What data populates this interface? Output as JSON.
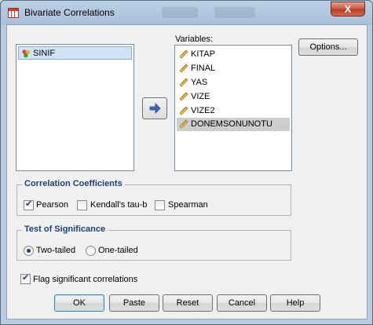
{
  "window": {
    "title": "Bivariate Correlations",
    "close_glyph": "X"
  },
  "source_list": {
    "items": [
      {
        "label": "SINIF",
        "selected": true
      }
    ]
  },
  "variables": {
    "label": "Variables:",
    "items": [
      {
        "label": "KITAP"
      },
      {
        "label": "FINAL"
      },
      {
        "label": "YAS"
      },
      {
        "label": "VIZE"
      },
      {
        "label": "VIZE2"
      },
      {
        "label": "DONEMSONUNOTU",
        "selected": true
      }
    ]
  },
  "buttons": {
    "options": "Options...",
    "ok": "OK",
    "paste": "Paste",
    "reset": "Reset",
    "cancel": "Cancel",
    "help": "Help"
  },
  "correlation": {
    "title": "Correlation Coefficients",
    "pearson": {
      "label": "Pearson",
      "checked": true
    },
    "kendall": {
      "label": "Kendall's tau-b",
      "checked": false
    },
    "spearman": {
      "label": "Spearman",
      "checked": false
    }
  },
  "significance": {
    "title": "Test of Significance",
    "two_tailed": {
      "label": "Two-tailed",
      "selected": true
    },
    "one_tailed": {
      "label": "One-tailed",
      "selected": false
    }
  },
  "flag": {
    "label": "Flag significant correlations",
    "checked": true
  },
  "colors": {
    "group_title": "#1e3f7a",
    "selection": "#cfe3f5",
    "close": "#c9563e"
  }
}
